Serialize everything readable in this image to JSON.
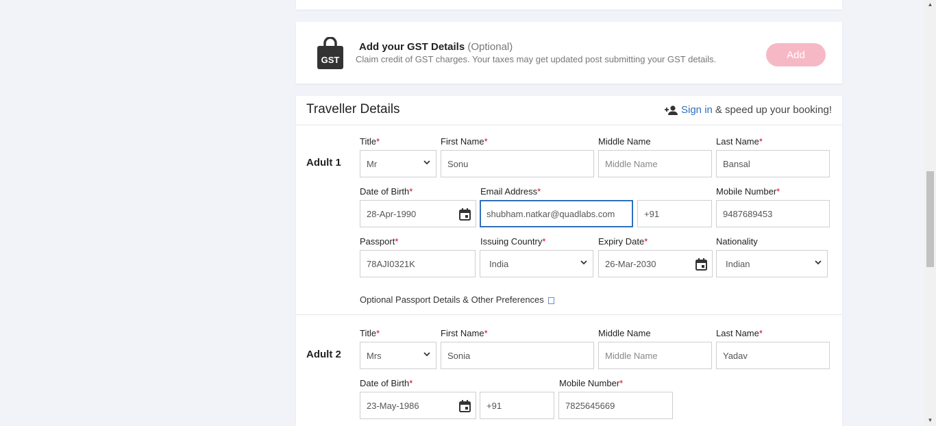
{
  "gst": {
    "icon_label": "GST",
    "title": "Add your GST Details",
    "optional": "(Optional)",
    "description": "Claim credit of GST charges. Your taxes may get updated post submitting your GST details.",
    "add_label": "Add"
  },
  "traveller": {
    "title": "Traveller Details",
    "sign_in": "Sign in",
    "sign_in_suffix": "& speed up your booking!",
    "adult1": {
      "label": "Adult 1",
      "title_label": "Title",
      "title_value": "Mr",
      "first_name_label": "First Name",
      "first_name_value": "Sonu",
      "middle_name_label": "Middle Name",
      "middle_name_placeholder": "Middle Name",
      "last_name_label": "Last Name",
      "last_name_value": "Bansal",
      "dob_label": "Date of Birth",
      "dob_value": "28-Apr-1990",
      "email_label": "Email Address",
      "email_value": "shubham.natkar@quadlabs.com",
      "country_code": "+91",
      "mobile_label": "Mobile Number",
      "mobile_value": "9487689453",
      "passport_label": "Passport",
      "passport_value": "78AJI0321K",
      "issuing_country_label": "Issuing Country",
      "issuing_country_value": "India",
      "expiry_label": "Expiry Date",
      "expiry_value": "26-Mar-2030",
      "nationality_label": "Nationality",
      "nationality_value": "Indian",
      "optional_prefs": "Optional Passport Details & Other Preferences"
    },
    "adult2": {
      "label": "Adult 2",
      "title_label": "Title",
      "title_value": "Mrs",
      "first_name_label": "First Name",
      "first_name_value": "Sonia",
      "middle_name_label": "Middle Name",
      "middle_name_placeholder": "Middle Name",
      "last_name_label": "Last Name",
      "last_name_value": "Yadav",
      "dob_label": "Date of Birth",
      "dob_value": "23-May-1986",
      "country_code": "+91",
      "mobile_label": "Mobile Number",
      "mobile_value": "7825645669"
    }
  },
  "colors": {
    "accent": "#2f6fbd",
    "add_button": "#f7b8c6",
    "required": "#d0021b"
  }
}
